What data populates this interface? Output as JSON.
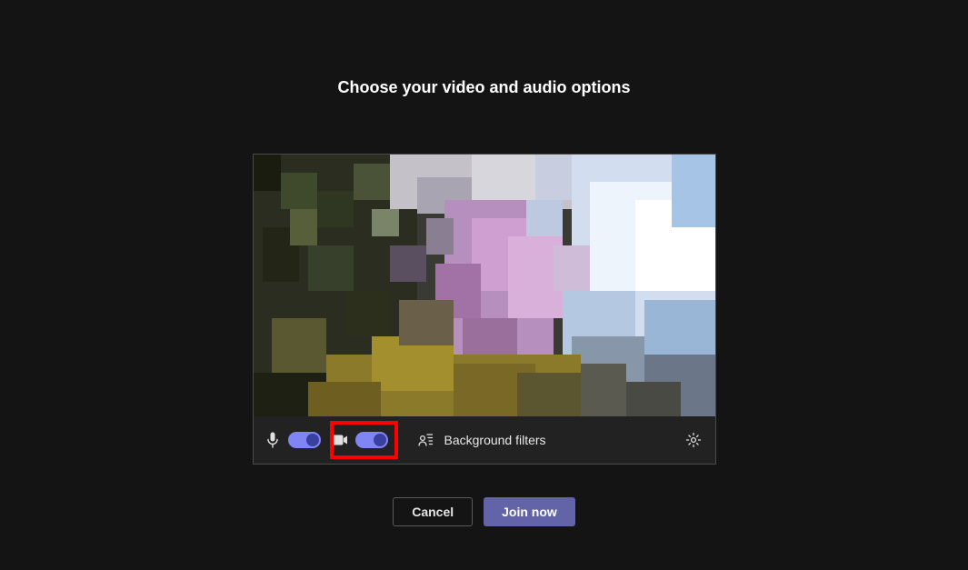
{
  "header": {
    "title": "Choose your video and audio options"
  },
  "toolbar": {
    "mic": {
      "on": true
    },
    "camera": {
      "on": true
    },
    "backgroundFiltersLabel": "Background filters"
  },
  "actions": {
    "cancel": "Cancel",
    "join": "Join now"
  },
  "colors": {
    "accent": "#6264a7",
    "toggleOn": "#7f85f5",
    "highlight": "#ff0000"
  },
  "icons": {
    "mic": "mic-icon",
    "camera": "camera-icon",
    "backgroundEffects": "background-effects-icon",
    "settings": "gear-icon"
  }
}
